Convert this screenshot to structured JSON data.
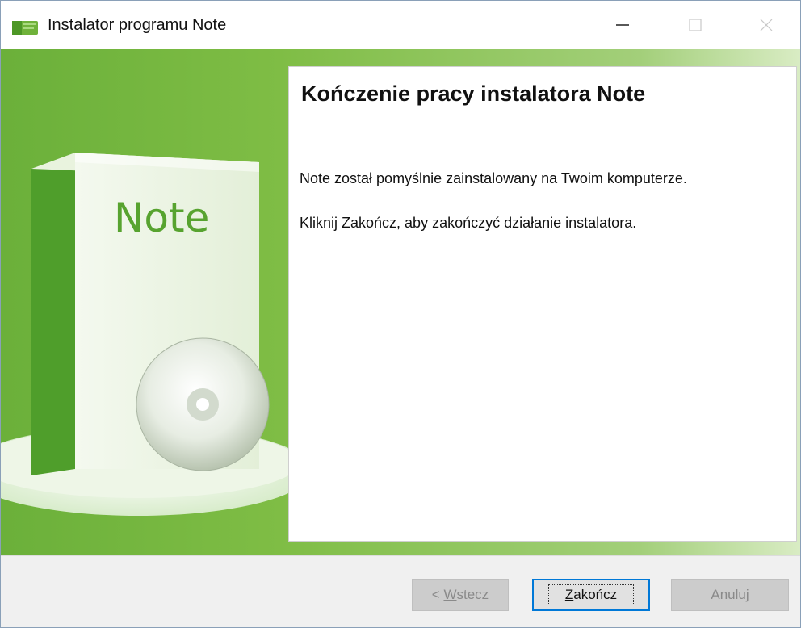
{
  "window": {
    "title": "Instalator programu Note"
  },
  "sidebar": {
    "box_label": "Note"
  },
  "main": {
    "heading": "Kończenie pracy instalatora Note",
    "line1": "Note został pomyślnie zainstalowany na Twoim komputerze.",
    "line2": "Kliknij Zakończ, aby zakończyć działanie instalatora."
  },
  "buttons": {
    "back": {
      "prefix": "< ",
      "mnemonic": "W",
      "rest": "stecz",
      "enabled": false
    },
    "finish": {
      "mnemonic": "Z",
      "rest": "akończ",
      "enabled": true,
      "focused": true
    },
    "cancel": {
      "label": "Anuluj",
      "enabled": false
    }
  },
  "colors": {
    "accent": "#0078d7",
    "brand_green": "#7fbd45",
    "dark_green": "#4f9e2b"
  }
}
